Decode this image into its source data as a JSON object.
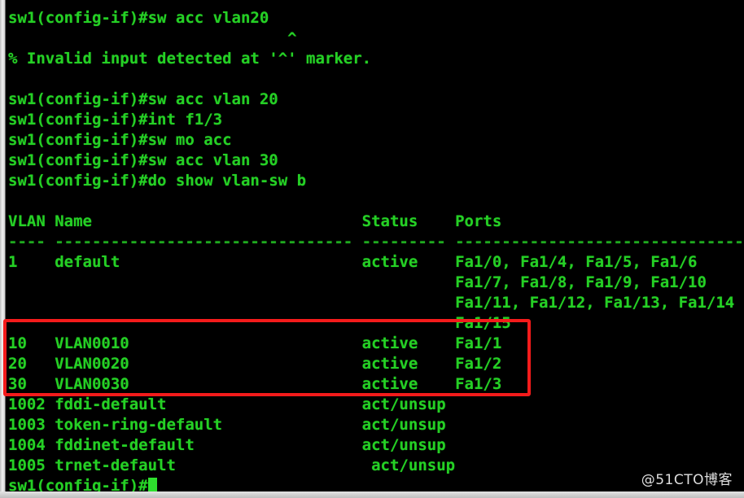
{
  "window": {
    "app": "terminal-emulator",
    "background_color": "#000000",
    "foreground_color": "#25d025",
    "frame_color": "#d9d9d9"
  },
  "terminal": {
    "prompt": "sw1(config-if)#",
    "cursor": "block-cursor",
    "lines": [
      {
        "id": "l01",
        "text": "sw1(config-if)#sw acc vlan20",
        "kind": "command"
      },
      {
        "id": "l02",
        "text": "                              ^",
        "kind": "caret-marker"
      },
      {
        "id": "l03",
        "text": "% Invalid input detected at '^' marker.",
        "kind": "error"
      },
      {
        "id": "l04",
        "text": "",
        "kind": "blank"
      },
      {
        "id": "l05",
        "text": "sw1(config-if)#sw acc vlan 20",
        "kind": "command"
      },
      {
        "id": "l06",
        "text": "sw1(config-if)#int f1/3",
        "kind": "command"
      },
      {
        "id": "l07",
        "text": "sw1(config-if)#sw mo acc",
        "kind": "command"
      },
      {
        "id": "l08",
        "text": "sw1(config-if)#sw acc vlan 30",
        "kind": "command"
      },
      {
        "id": "l09",
        "text": "sw1(config-if)#do show vlan-sw b",
        "kind": "command"
      },
      {
        "id": "l10",
        "text": "",
        "kind": "blank"
      },
      {
        "id": "l11",
        "text": "VLAN Name                             Status    Ports",
        "kind": "table-header"
      },
      {
        "id": "l12",
        "text": "---- -------------------------------- --------- -------------------------------",
        "kind": "table-rule"
      },
      {
        "id": "l13",
        "text": "1    default                          active    Fa1/0, Fa1/4, Fa1/5, Fa1/6",
        "kind": "table-row"
      },
      {
        "id": "l14",
        "text": "                                                Fa1/7, Fa1/8, Fa1/9, Fa1/10",
        "kind": "table-row-cont"
      },
      {
        "id": "l15",
        "text": "                                                Fa1/11, Fa1/12, Fa1/13, Fa1/14",
        "kind": "table-row-cont"
      },
      {
        "id": "l16",
        "text": "                                                Fa1/15",
        "kind": "table-row-cont"
      },
      {
        "id": "l17",
        "text": "10   VLAN0010                         active    Fa1/1",
        "kind": "table-row"
      },
      {
        "id": "l18",
        "text": "20   VLAN0020                         active    Fa1/2",
        "kind": "table-row"
      },
      {
        "id": "l19",
        "text": "30   VLAN0030                         active    Fa1/3",
        "kind": "table-row"
      },
      {
        "id": "l20",
        "text": "1002 fddi-default                     act/unsup",
        "kind": "table-row"
      },
      {
        "id": "l21",
        "text": "1003 token-ring-default               act/unsup",
        "kind": "table-row"
      },
      {
        "id": "l22",
        "text": "1004 fddinet-default                  act/unsup",
        "kind": "table-row"
      },
      {
        "id": "l23",
        "text": "1005 trnet-default                     act/unsup",
        "kind": "table-row"
      },
      {
        "id": "l24",
        "text": "sw1(config-if)#",
        "kind": "prompt-active"
      }
    ]
  },
  "vlan_table": {
    "columns": [
      "VLAN",
      "Name",
      "Status",
      "Ports"
    ],
    "rows": [
      {
        "vlan": "1",
        "name": "default",
        "status": "active",
        "ports": "Fa1/0, Fa1/4, Fa1/5, Fa1/6, Fa1/7, Fa1/8, Fa1/9, Fa1/10, Fa1/11, Fa1/12, Fa1/13, Fa1/14, Fa1/15"
      },
      {
        "vlan": "10",
        "name": "VLAN0010",
        "status": "active",
        "ports": "Fa1/1"
      },
      {
        "vlan": "20",
        "name": "VLAN0020",
        "status": "active",
        "ports": "Fa1/2"
      },
      {
        "vlan": "30",
        "name": "VLAN0030",
        "status": "active",
        "ports": "Fa1/3"
      },
      {
        "vlan": "1002",
        "name": "fddi-default",
        "status": "act/unsup",
        "ports": ""
      },
      {
        "vlan": "1003",
        "name": "token-ring-default",
        "status": "act/unsup",
        "ports": ""
      },
      {
        "vlan": "1004",
        "name": "fddinet-default",
        "status": "act/unsup",
        "ports": ""
      },
      {
        "vlan": "1005",
        "name": "trnet-default",
        "status": "act/unsup",
        "ports": ""
      }
    ]
  },
  "annotation": {
    "type": "rectangle-highlight",
    "color": "#f41b1b",
    "covers": "VLAN rows 10, 20 and 30"
  },
  "watermark": {
    "text": "@51CTO博客"
  }
}
